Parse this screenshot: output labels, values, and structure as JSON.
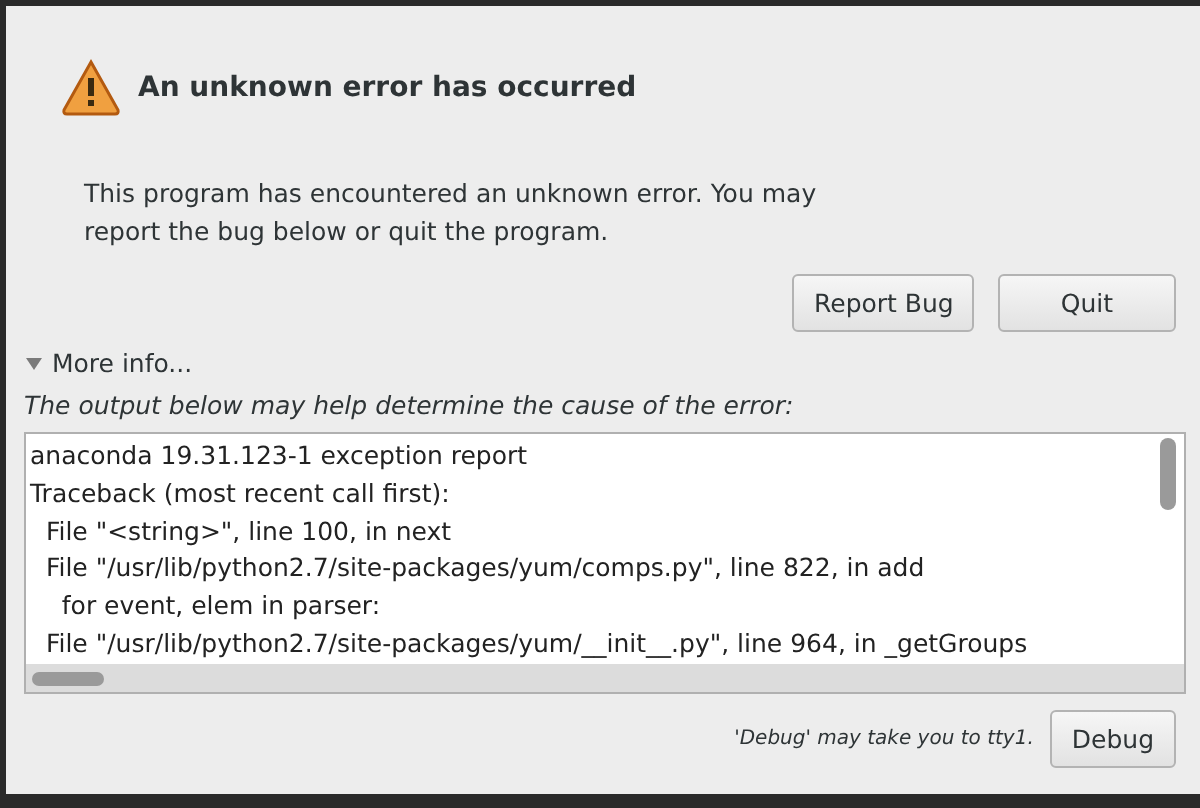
{
  "dialog": {
    "title": "An unknown error has occurred",
    "message": "This program has encountered an unknown error. You may report the bug below or quit the program.",
    "buttons": [
      "Report Bug",
      "Quit"
    ],
    "expander": {
      "label": "More info...",
      "expanded": true
    },
    "hint": "The output below may help determine the cause of the error:",
    "log_lines": [
      "anaconda 19.31.123-1 exception report",
      "Traceback (most recent call first):",
      "  File \"<string>\", line 100, in next",
      "  File \"/usr/lib/python2.7/site-packages/yum/comps.py\", line 822, in add",
      "    for event, elem in parser:",
      "  File \"/usr/lib/python2.7/site-packages/yum/__init__.py\", line 964, in _getGroups"
    ],
    "debug_note": "'Debug' may take you to tty1.",
    "debug_button": "Debug"
  }
}
